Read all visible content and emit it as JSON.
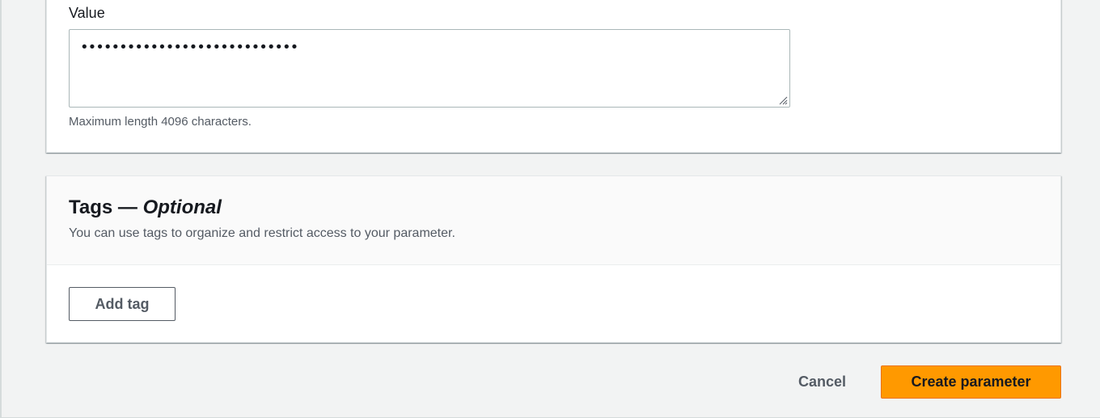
{
  "value_field": {
    "label": "Value",
    "masked_value": "••••••••••••••••••••••••••••",
    "constraint_text": "Maximum length 4096 characters."
  },
  "tags_section": {
    "title": "Tags —",
    "title_optional": "Optional",
    "description": "You can use tags to organize and restrict access to your parameter.",
    "add_tag_label": "Add tag"
  },
  "actions": {
    "cancel_label": "Cancel",
    "create_label": "Create parameter"
  },
  "colors": {
    "primary_button": "#ff9900",
    "focus_accent": "#0073bb",
    "page_background": "#f2f3f3"
  }
}
